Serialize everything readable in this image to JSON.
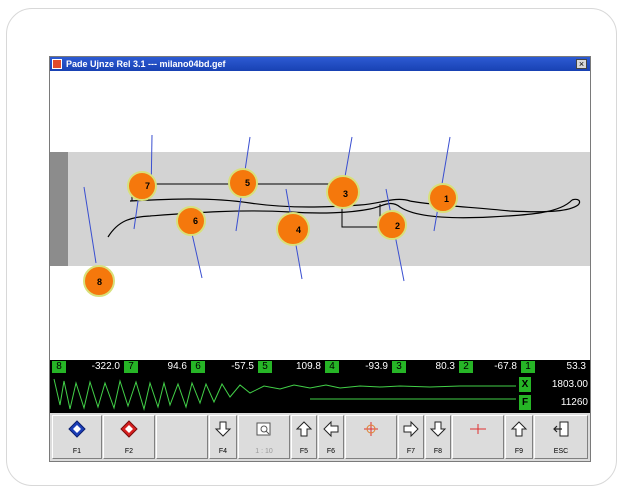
{
  "window": {
    "title": "Pade Ujnze Rel 3.1 --- milano04bd.gef",
    "close_glyph": "×"
  },
  "nodes": [
    {
      "id": "1"
    },
    {
      "id": "2"
    },
    {
      "id": "3"
    },
    {
      "id": "4"
    },
    {
      "id": "5"
    },
    {
      "id": "6"
    },
    {
      "id": "7"
    },
    {
      "id": "8"
    }
  ],
  "readouts": [
    {
      "id": "8",
      "value": "-322.0"
    },
    {
      "id": "7",
      "value": "94.6"
    },
    {
      "id": "6",
      "value": "-57.5"
    },
    {
      "id": "5",
      "value": "109.8"
    },
    {
      "id": "4",
      "value": "-93.9"
    },
    {
      "id": "3",
      "value": "80.3"
    },
    {
      "id": "2",
      "value": "-67.8"
    },
    {
      "id": "1",
      "value": "53.3"
    }
  ],
  "side_panel": {
    "x_label": "X",
    "x_value": "1803.00",
    "f_label": "F",
    "f_value": "11260"
  },
  "toolbar": {
    "keys": [
      {
        "label": "F1",
        "icon": "diamond-blue-icon"
      },
      {
        "label": "F2",
        "icon": "diamond-red-icon"
      },
      {
        "label": "",
        "icon": ""
      },
      {
        "label": "F4",
        "icon": "arrow-down-icon"
      },
      {
        "label": "1 : 10",
        "icon": "zoom-page-icon"
      },
      {
        "label": "F5",
        "icon": "arrow-up-icon"
      },
      {
        "label": "F6",
        "icon": "arrow-left-icon"
      },
      {
        "label": "",
        "icon": "crosshair-icon"
      },
      {
        "label": "F7",
        "icon": "arrow-right-icon"
      },
      {
        "label": "F8",
        "icon": "arrow-down-icon"
      },
      {
        "label": "",
        "icon": "crosshair-flat-icon"
      },
      {
        "label": "F9",
        "icon": "arrow-up-icon"
      },
      {
        "label": "ESC",
        "icon": "exit-door-icon"
      }
    ]
  },
  "colors": {
    "node_fill": "#f5780c",
    "node_ring": "#d8e07a",
    "band": "#d3d3d3",
    "line_blue": "#3a4fd0",
    "readout_green": "#26b526",
    "signal_green": "#42d048",
    "titlebar_blue": "#1f48c0"
  }
}
